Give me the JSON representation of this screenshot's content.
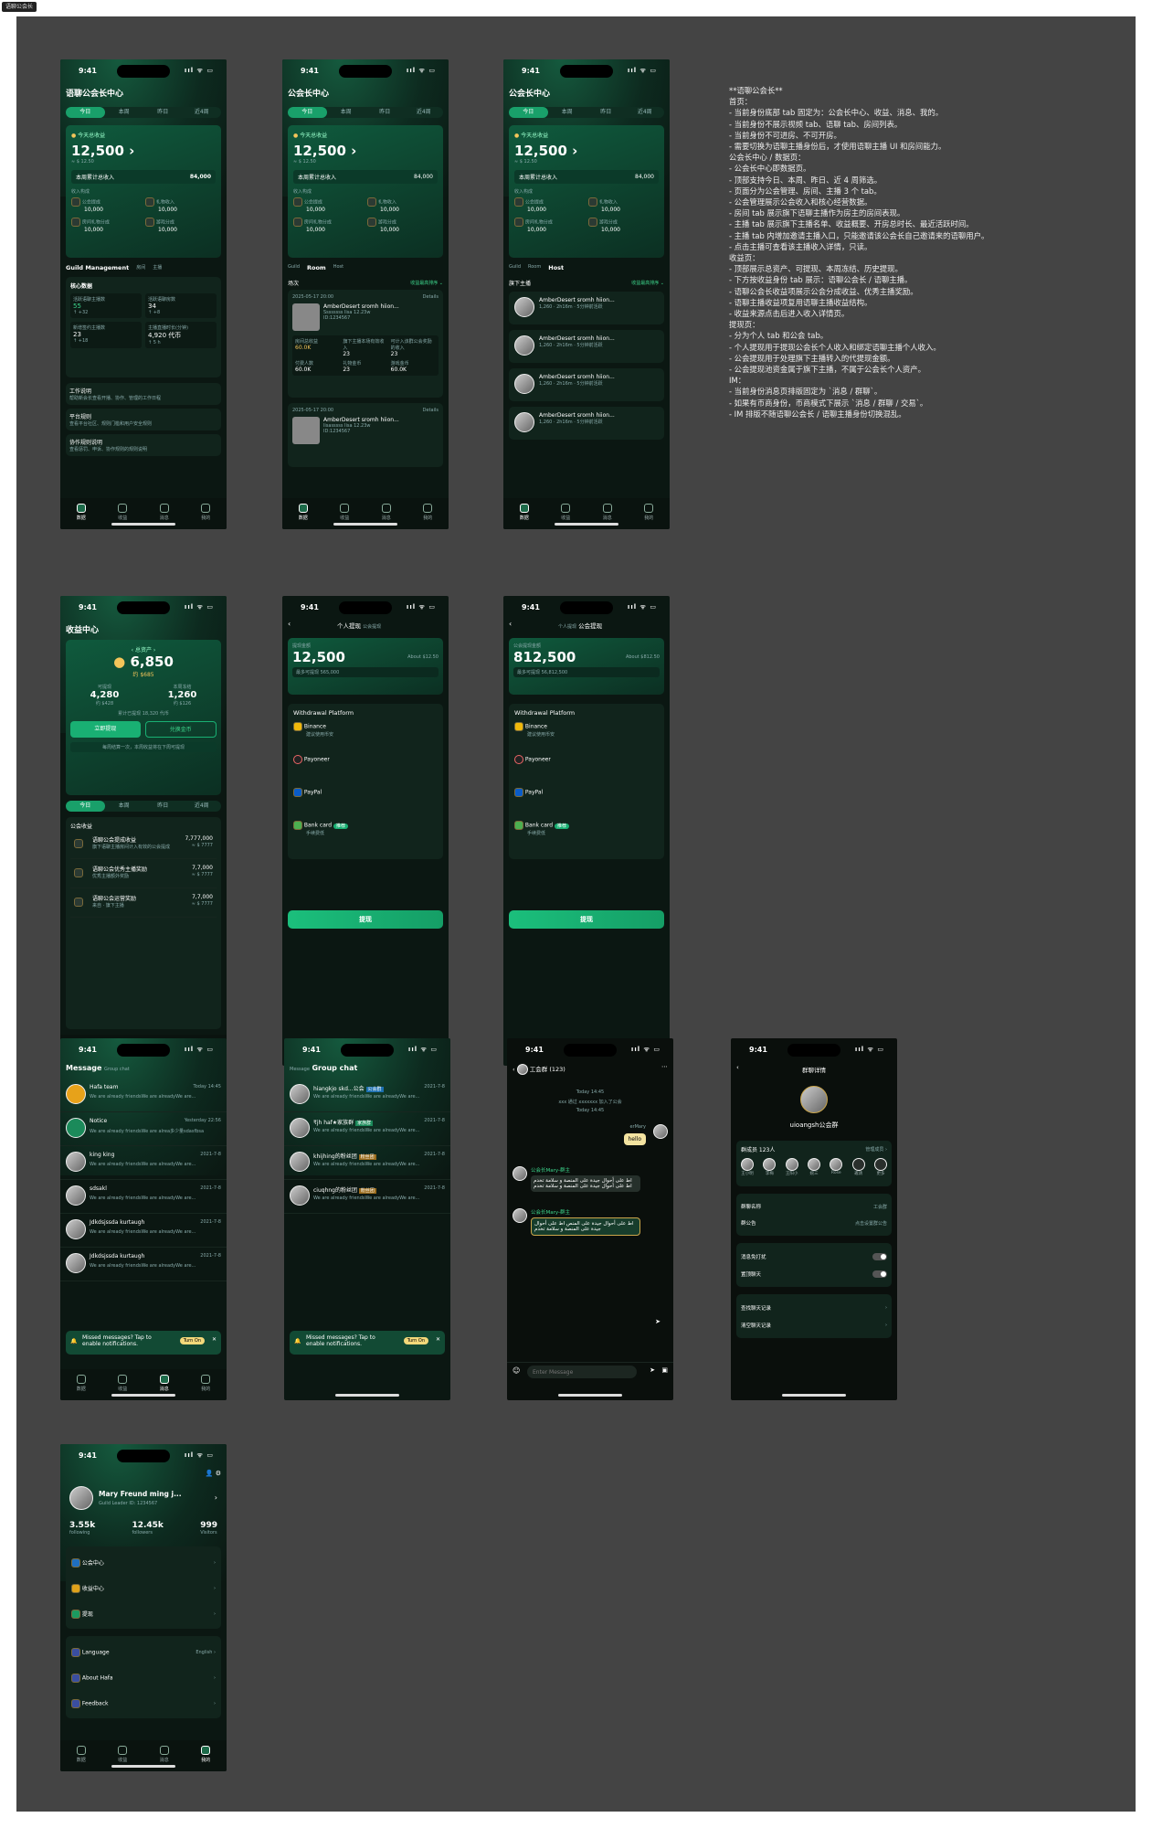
{
  "canvas_label": "语聊公会长",
  "status_time": "9:41",
  "status_icons": "ııl ᯤ ▭",
  "tabbar": [
    "数据",
    "收益",
    "消息",
    "我的"
  ],
  "period_tabs": [
    "今日",
    "本周",
    "昨日",
    "近4周"
  ],
  "home": {
    "title_full": "语聊公会长中心",
    "title": "公会长中心",
    "today_label": "今天总收益",
    "today_value": "12,500",
    "today_sub": "≈ $ 12.50",
    "week_label": "本周累计总收入",
    "week_value": "84,000",
    "compose_label": "收入构成",
    "compose": [
      {
        "label": "公会提成",
        "value": "10,000"
      },
      {
        "label": "礼物收入",
        "value": "10,000"
      },
      {
        "label": "房间礼物分成",
        "value": "10,000"
      },
      {
        "label": "游戏分成",
        "value": "10,000"
      }
    ],
    "section_tabs": [
      "Guild Management",
      "房间",
      "主播"
    ],
    "section_tabs2": [
      "Guild",
      "Room",
      "Host"
    ],
    "core_label": "核心数据",
    "core": [
      {
        "label": "活跃语聊主播数",
        "value": "55",
        "delta": "↑ +32"
      },
      {
        "label": "活跃语聊房数",
        "value": "34",
        "delta": "↑ +8"
      },
      {
        "label": "新增签约主播数",
        "value": "23",
        "delta": "↑ +18"
      },
      {
        "label": "主播直播时长(分钟)",
        "value": "4,920 代币",
        "delta": "↑ 5 h"
      }
    ],
    "links": [
      {
        "title": "工作说明",
        "desc": "帮助新会长查看开播、协作、管理的工作日程"
      },
      {
        "title": "平台规则",
        "desc": "查看平台社区、规则门槛和用户安全规则"
      },
      {
        "title": "协作规则说明",
        "desc": "查看惩罚、申诉、协作规则的规则说明"
      }
    ]
  },
  "room": {
    "list_label": "场次",
    "filter": "收益最高排序 ⌄",
    "items": [
      {
        "date": "2025-05-17 20:00",
        "details": "Details",
        "name": "AmberDesert sromh hiion...",
        "dur": "2h16m",
        "host": "Ssssssss lisa",
        "badge": "主播数量",
        "num": "12.23w",
        "id": "ID:1234567",
        "stats": [
          {
            "l": "房间总收益",
            "v": "60.0K"
          },
          {
            "l": "旗下主播本场有效收入",
            "v": "23"
          },
          {
            "l": "可计入该群公会奖励的收入",
            "v": "23"
          },
          {
            "l": "付费人数",
            "v": "60.0K"
          },
          {
            "l": "礼物金币",
            "v": "23"
          },
          {
            "l": "游戏金币",
            "v": "60.0K"
          }
        ]
      },
      {
        "date": "2025-05-17 20:00",
        "details": "Details",
        "name": "AmberDesert sromh hiion...",
        "dur": "2h16m",
        "host": "lisasssss lisa",
        "badge": "主播数量",
        "num": "12.23w",
        "id": "ID:1234567",
        "stats": [
          {
            "l": "房间总收益",
            "v": ""
          },
          {
            "l": "旗下主播本场有效收入",
            "v": ""
          },
          {
            "l": "可计入该群公会奖励的收入",
            "v": ""
          }
        ]
      }
    ]
  },
  "host": {
    "list_label": "旗下主播",
    "filter": "收益最高排序 ⌄",
    "items": [
      {
        "name": "AmberDesert sromh hiion...",
        "meta": "1,260 · 2h16m · 5分钟前活跃"
      },
      {
        "name": "AmberDesert sromh hiion...",
        "meta": "1,260 · 2h16m · 5分钟前活跃"
      },
      {
        "name": "AmberDesert sromh hiion...",
        "meta": "1,260 · 2h16m · 5分钟前活跃"
      },
      {
        "name": "AmberDesert sromh hiion...",
        "meta": "1,260 · 2h16m · 5分钟前活跃"
      }
    ]
  },
  "notes": "**语聊公会长**\n首页：\n- 当前身份底部 tab 固定为：公会长中心、收益、消息、我的。\n- 当前身份不展示视频 tab、语聊 tab、房间列表。\n- 当前身份不可进房、不可开房。\n- 需要切换为语聊主播身份后，才使用语聊主播 UI 和房间能力。\n公会长中心 / 数据页：\n- 公会长中心即数据页。\n- 顶部支持今日、本周、昨日、近 4 周筛选。\n- 页面分为公会管理、房间、主播 3 个 tab。\n- 公会管理展示公会收入和核心经营数据。\n- 房间 tab 展示旗下语聊主播作为房主的房间表现。\n- 主播 tab 展示旗下主播名单、收益概要、开房总时长、最近活跃时间。\n- 主播 tab 内增加邀请主播入口，只能邀请该公会长自己邀请来的语聊用户。\n- 点击主播可查看该主播收入详情，只读。\n收益页：\n- 顶部展示总资产、可提现、本周冻结、历史提现。\n- 下方按收益身份 tab 展示：语聊公会长 / 语聊主播。\n- 语聊公会长收益项展示公会分成收益、优秀主播奖励。\n- 语聊主播收益项复用语聊主播收益结构。\n- 收益来源点击后进入收入详情页。\n提现页：\n- 分为个人 tab 和公会 tab。\n- 个人提现用于提现公会长个人收入和绑定语聊主播个人收入。\n- 公会提现用于处理旗下主播转入的代提现金额。\n- 公会提现池资金属于旗下主播，不属于公会长个人资产。\nIM：\n- 当前身份消息页排版固定为 `消息 / 群聊`。\n- 如果有币商身份，币商模式下展示 `消息 / 群聊 / 交易`。\n- IM 排版不随语聊公会长 / 语聊主播身份切换混乱。",
  "income": {
    "title": "收益中心",
    "total_label": "总资产",
    "total": "6,850",
    "total_usd": "约 $685",
    "withdrawable_label": "可提现",
    "withdrawable": "4,280",
    "withdrawable_usd": "约 $428",
    "frozen_label": "本周冻结",
    "frozen": "1,260",
    "frozen_usd": "约 $126",
    "history": "累计已提现 18,320 代币",
    "btn_withdraw": "立即提现",
    "btn_exchange": "兑换金币",
    "tip": "每周结算一次，本周收益将在下周可提现",
    "guild_label": "公会收益",
    "items": [
      {
        "title": "语聊公会提成收益",
        "desc": "旗下语聊主播房间计入有效的公会提成",
        "value": "7,777,000",
        "usd": "≈ $ 7777"
      },
      {
        "title": "语聊公会优秀主播奖励",
        "desc": "优秀主播额外奖励",
        "value": "7,7,000",
        "usd": "≈ $ 7777"
      },
      {
        "title": "语聊公会运营奖励",
        "desc": "来自 · 旗下主播",
        "value": "7,7,000",
        "usd": "≈ $ 7777"
      }
    ]
  },
  "withdraw_personal": {
    "tabs": [
      "个人提现",
      "公会提现"
    ],
    "label": "提现金额",
    "value": "12,500",
    "about": "About $12.50",
    "min": "最多可提现 565,000",
    "platform_label": "Withdrawal Platform",
    "platforms": [
      {
        "name": "Binance",
        "sub": "建议使用币安"
      },
      {
        "name": "Payoneer",
        "sub": ""
      },
      {
        "name": "PayPal",
        "sub": ""
      },
      {
        "name": "Bank card",
        "sub": "手续费低",
        "tag": "推荐"
      }
    ],
    "btn": "提现"
  },
  "withdraw_guild": {
    "label": "公会提现金额",
    "value": "812,500",
    "about": "About $812.50",
    "min": "最多可提现 56,812,500"
  },
  "messages": {
    "tabs": [
      "Message",
      "Group chat"
    ],
    "items": [
      {
        "name": "Hafa team",
        "badge": "3",
        "time": "Today 14:45",
        "text": "We are already friendsWe are alreadyWe are..."
      },
      {
        "name": "Notice",
        "badge": "",
        "time": "Yesterday 22:56",
        "text": "We are already friendsWe are alrea多少量sdasfbsa"
      },
      {
        "name": "king king",
        "badge": "",
        "time": "2021-7-8",
        "text": "We are already friendsWe are alreadyWe are..."
      },
      {
        "name": "sdsakl",
        "badge": "",
        "time": "2021-7-8",
        "text": "We are already friendsWe are alreadyWe are..."
      },
      {
        "name": "Jdkdsjssda kurtaugh",
        "badge": "",
        "time": "2021-7-8",
        "text": "We are already friendsWe are alreadyWe are..."
      },
      {
        "name": "Jdkdsjssda kurtaugh",
        "badge": "",
        "time": "2021-7-8",
        "text": "We are already friendsWe are alreadyWe are..."
      }
    ],
    "notify": "Missed messages? Tap to enable notifications.",
    "notify_btn": "Turn On"
  },
  "groups": {
    "items": [
      {
        "name": "hiangkjo skd...公会",
        "tag": "公会群",
        "time": "2021-7-8",
        "text": "We are already friendsWe are alreadyWe are..."
      },
      {
        "name": "₹jh haf★家族群",
        "tag": "家族群",
        "time": "2021-7-8",
        "text": "We are already friendsWe are alreadyWe are..."
      },
      {
        "name": "khijhing的粉丝团",
        "tag": "粉丝团",
        "time": "2021-7-8",
        "text": "We are already friendsWe are alreadyWe are..."
      },
      {
        "name": "ciuqhng的粉丝团",
        "tag": "粉丝团",
        "time": "2021-7-8",
        "text": "We are already friendsWe are alreadyWe are..."
      }
    ]
  },
  "chat": {
    "title": "工会群 (123)",
    "t1": "Today 14:45",
    "sys": "xxx 通过 xxxxxxx 加入了公会",
    "t2": "Today 14:45",
    "me": "erMary",
    "me_msg": "hello",
    "sender": "公会长Mary-群主",
    "msg1": "اط على أحوال جيدة على المنصة و سلامة تخدم اط على أحوال جيدة على المنصة و سلامة تخدم",
    "msg2": "اط على أحوال جيدة على المنص اط على أحوال جيدة على المنصة و سلامة تخدم",
    "placeholder": "Enter Message"
  },
  "group_detail": {
    "title": "群聊详情",
    "name": "uioangsh公会群",
    "members_label": "群成员 123人",
    "manage": "管理成员 ›",
    "members": [
      "王小明",
      "李梅",
      "王阳小",
      "婉三",
      "Rose",
      "邀请",
      "更多"
    ],
    "rows1": [
      {
        "l": "群聊名称",
        "v": "工会群"
      },
      {
        "l": "群公告",
        "v": "点击设置群公告"
      }
    ],
    "rows2": [
      {
        "l": "消息免打扰"
      },
      {
        "l": "置顶聊天"
      }
    ],
    "rows3": [
      {
        "l": "查找聊天记录"
      },
      {
        "l": "清空聊天记录"
      }
    ]
  },
  "profile": {
    "name": "Mary Freund ming j...",
    "sub": "Guild Leader ID: 1234567",
    "stats": [
      {
        "v": "3.55k",
        "l": "following"
      },
      {
        "v": "12.45k",
        "l": "followers"
      },
      {
        "v": "999",
        "l": "Visitors"
      }
    ],
    "menu1": [
      "公会中心",
      "收益中心",
      "提现"
    ],
    "menu2": [
      {
        "l": "Language",
        "v": "English"
      },
      {
        "l": "About Hafa",
        "v": ""
      },
      {
        "l": "Feedback",
        "v": ""
      }
    ]
  }
}
